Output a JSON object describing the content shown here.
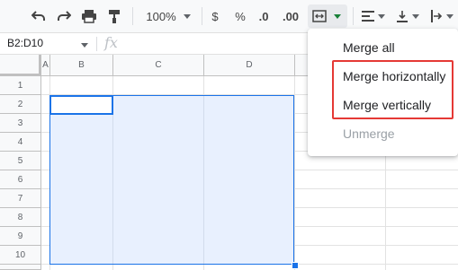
{
  "toolbar": {
    "zoom": "100%",
    "currency": "$",
    "percent": "%",
    "decrease_decimal": ".0",
    "increase_decimal": ".00"
  },
  "formula_bar": {
    "name_box": "B2:D10",
    "fx": "fx"
  },
  "sheet": {
    "columns": [
      "A",
      "B",
      "C",
      "D"
    ],
    "rows": [
      "1",
      "2",
      "3",
      "4",
      "5",
      "6",
      "7",
      "8",
      "9",
      "10"
    ]
  },
  "merge_menu": {
    "items": [
      {
        "label": "Merge all",
        "enabled": true
      },
      {
        "label": "Merge horizontally",
        "enabled": true
      },
      {
        "label": "Merge vertically",
        "enabled": true
      },
      {
        "label": "Unmerge",
        "enabled": false
      }
    ]
  },
  "colors": {
    "selection": "#e8f0fe",
    "accent": "#1a73e8",
    "highlight": "#e53935"
  }
}
